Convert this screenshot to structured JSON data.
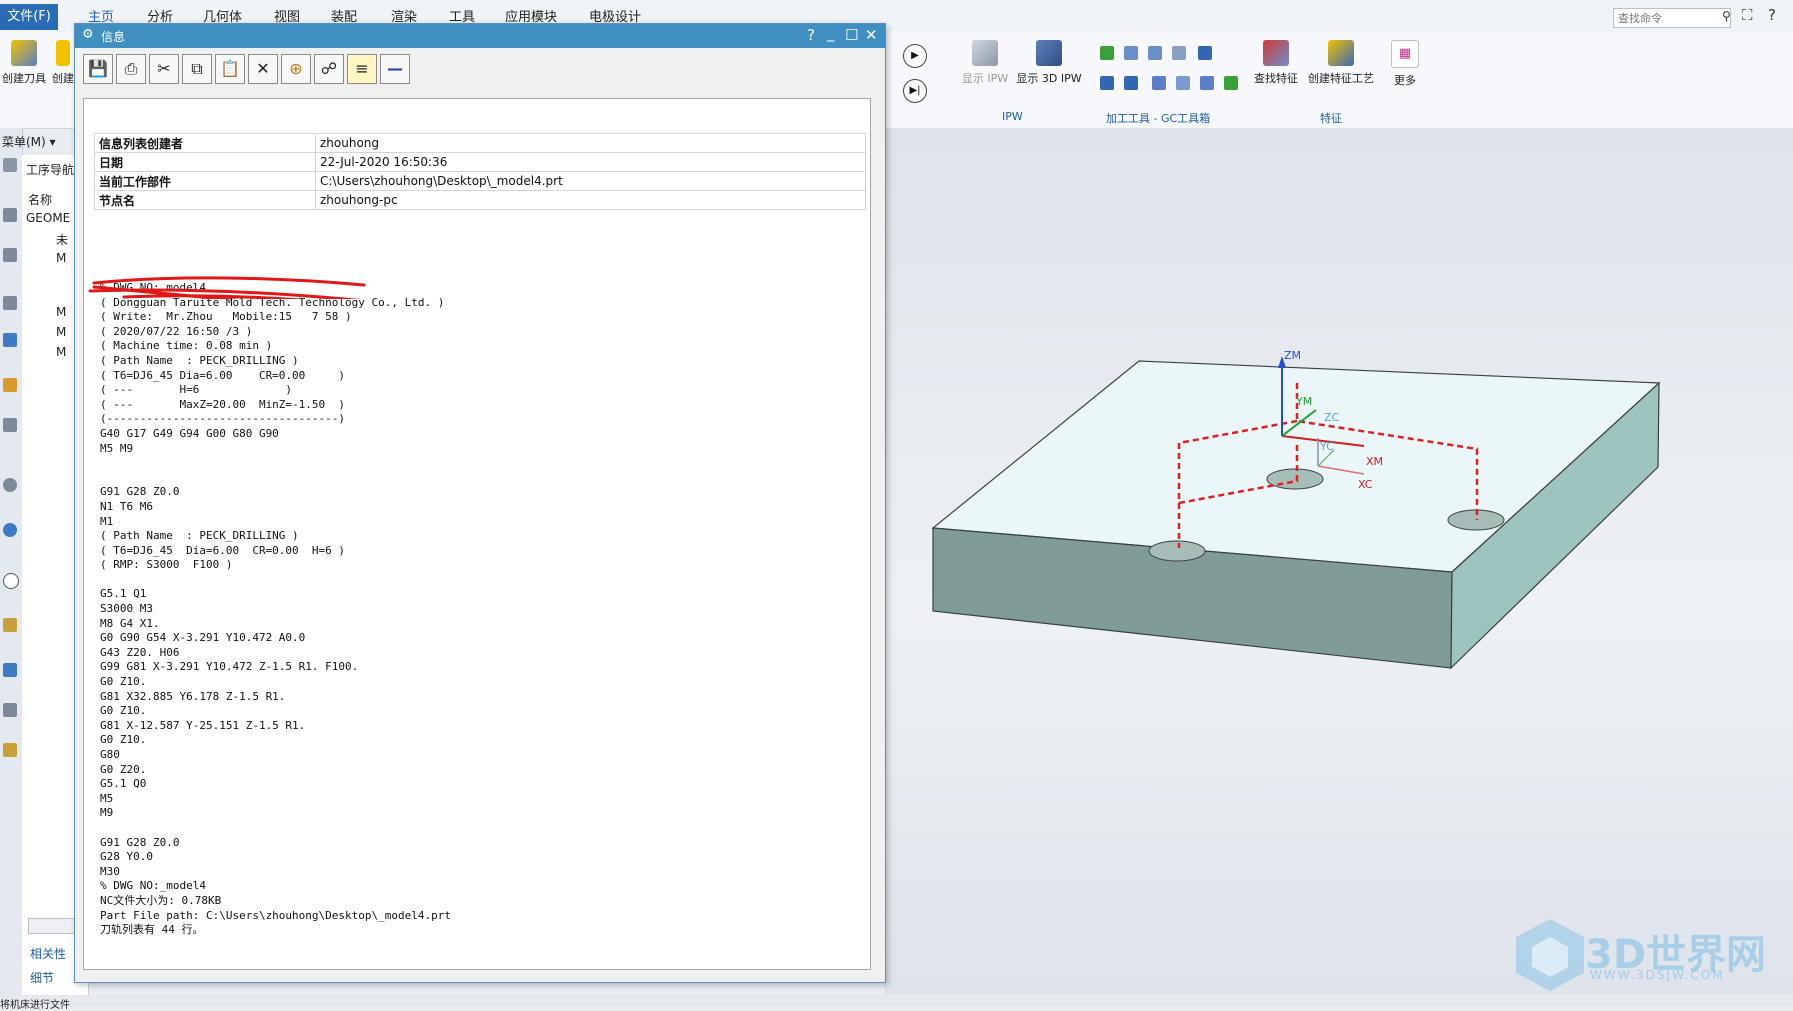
{
  "menubar": {
    "file": "文件(F)",
    "tabs": [
      "主页",
      "分析",
      "几何体",
      "视图",
      "装配",
      "渲染",
      "工具",
      "应用模块",
      "电极设计"
    ],
    "search_placeholder": "查找命令"
  },
  "ribbon": {
    "left_buttons": [
      "创建刀具",
      "创建"
    ],
    "ipw_buttons": [
      "显示 IPW",
      "显示 3D IPW"
    ],
    "feature_buttons": [
      "查找特征",
      "创建特征工艺",
      "更多"
    ],
    "groups": [
      "IPW",
      "加工工具 - GC工具箱",
      "特征"
    ]
  },
  "left_panel": {
    "menu_label": "菜单(M)",
    "navigator_title": "工序导航",
    "column_name": "名称",
    "geometry_row": "GEOME",
    "unused_row": "未",
    "items": [
      "M",
      "M",
      "M",
      "M"
    ],
    "bottom_tabs": [
      "相关性",
      "细节"
    ]
  },
  "dialog": {
    "title": "信息",
    "controls": {
      "help": "?",
      "minimize": "_",
      "maximize": "☐",
      "close": "✕"
    },
    "toolbar_icons": [
      "save-icon",
      "print-icon",
      "cut-icon",
      "copy-icon",
      "paste-icon",
      "delete-icon",
      "select-icon",
      "find-icon",
      "wrap-icon",
      "minus-icon"
    ],
    "info_rows": [
      {
        "key": "信息列表创建者",
        "value": "zhouhong"
      },
      {
        "key": "日期",
        "value": "22-Jul-2020 16:50:36"
      },
      {
        "key": "当前工作部件",
        "value": "C:\\Users\\zhouhong\\Desktop\\_model4.prt"
      },
      {
        "key": "节点名",
        "value": "zhouhong-pc"
      }
    ],
    "code": "% DWG NO: model4\n( Dongguan Taruite Mold Tech. Technology Co., Ltd. )\n( Write:  Mr.Zhou   Mobile:15   7 58 )\n( 2020/07/22 16:50 /3 )\n( Machine time: 0.08 min )\n( Path Name  : PECK_DRILLING )\n( T6=DJ6_45 Dia=6.00    CR=0.00     )\n( ---       H=6             )\n( ---       MaxZ=20.00  MinZ=-1.50  )\n(-----------------------------------)\nG40 G17 G49 G94 G00 G80 G90\nM5 M9\n\n\nG91 G28 Z0.0\nN1 T6 M6\nM1\n( Path Name  : PECK_DRILLING )\n( T6=DJ6_45  Dia=6.00  CR=0.00  H=6 )\n( RMP: S3000  F100 )\n\nG5.1 Q1\nS3000 M3\nM8 G4 X1.\nG0 G90 G54 X-3.291 Y10.472 A0.0\nG43 Z20. H06\nG99 G81 X-3.291 Y10.472 Z-1.5 R1. F100.\nG0 Z10.\nG81 X32.885 Y6.178 Z-1.5 R1.\nG0 Z10.\nG81 X-12.587 Y-25.151 Z-1.5 R1.\nG0 Z10.\nG80\nG0 Z20.\nG5.1 Q0\nM5\nM9\n\nG91 G28 Z0.0\nG28 Y0.0\nM30\n% DWG NO:_model4\nNC文件大小为: 0.78KB\nPart File path: C:\\Users\\zhouhong\\Desktop\\_model4.prt\n刀轨列表有 44 行。"
  },
  "viewport": {
    "axis_labels": [
      "ZM",
      "YM",
      "ZC",
      "YC",
      "XM",
      "XC"
    ],
    "colors": {
      "top_face": "#eaf6f8",
      "front_face": "#7f9c99",
      "side_face": "#9ec4bf",
      "path": "#e02020"
    }
  },
  "status": {
    "text": "将机床进行文件"
  },
  "watermark": {
    "title": "3D世界网",
    "url": "WWW.3DSJW.COM"
  }
}
